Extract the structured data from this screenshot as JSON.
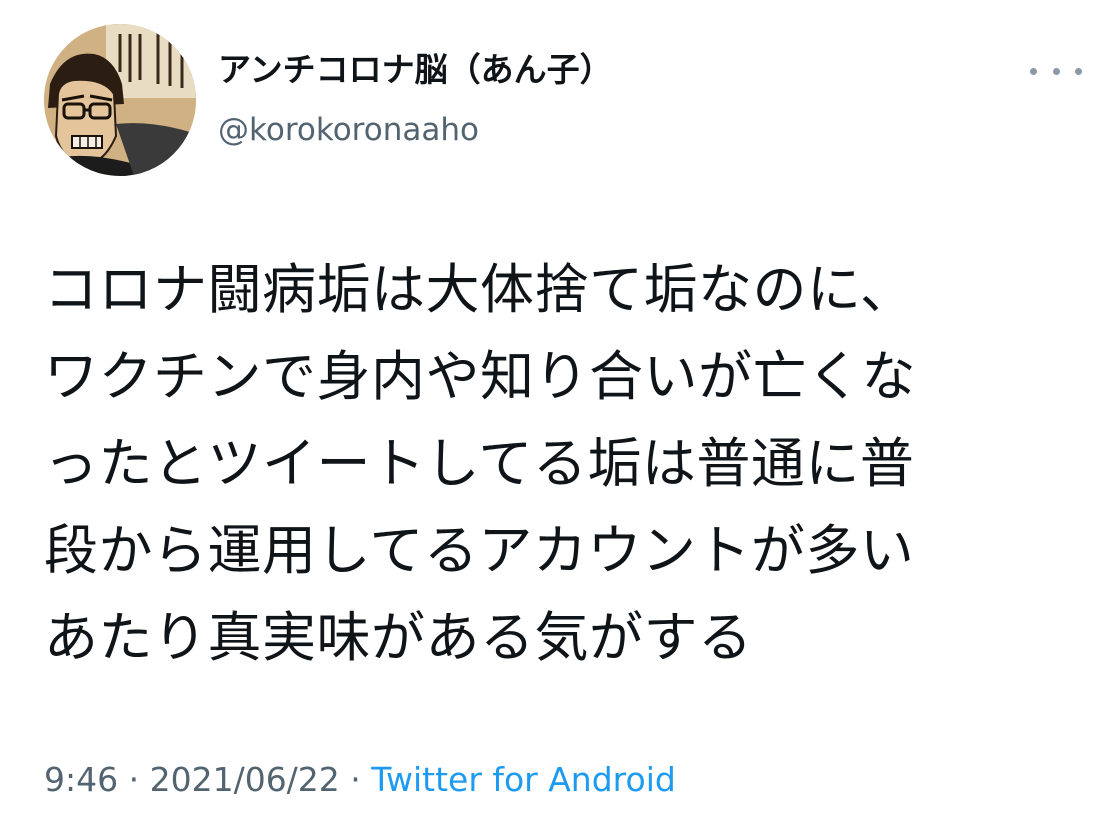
{
  "author": {
    "display_name": "アンチコロナ脳（あん子）",
    "handle": "@korokoronaaho",
    "avatar_icon": "manga-character-avatar"
  },
  "more_icon": "more-options-icon",
  "tweet": {
    "lines": [
      "コロナ闘病垢は大体捨て垢なのに、",
      "ワクチンで身内や知り合いが亡くな",
      "ったとツイートしてる垢は普通に普",
      "段から運用してるアカウントが多い",
      "あたり真実味がある気がする"
    ]
  },
  "meta": {
    "time": "9:46",
    "separator": " · ",
    "date": "2021/06/22",
    "source": "Twitter for Android"
  },
  "colors": {
    "text": "#0f1419",
    "secondary": "#536471",
    "link": "#1d9bf0"
  }
}
